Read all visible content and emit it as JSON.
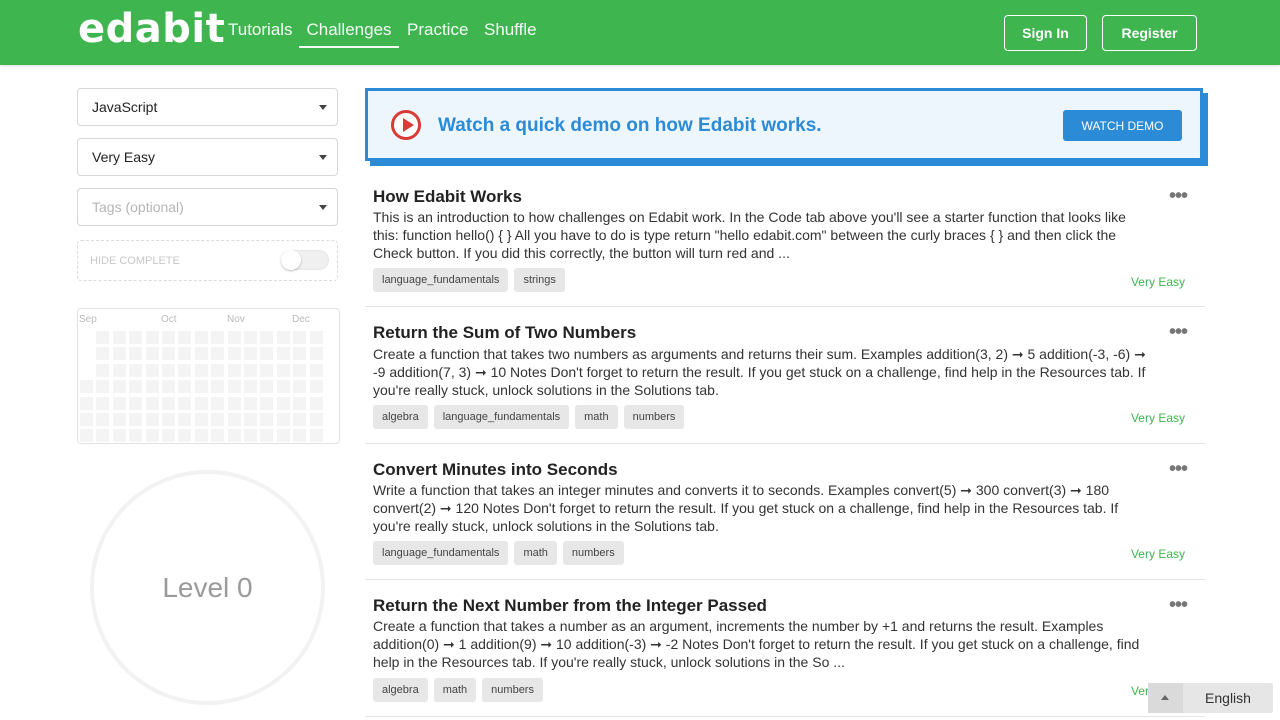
{
  "header": {
    "logo": "edabit",
    "nav": [
      "Tutorials",
      "Challenges",
      "Practice",
      "Shuffle"
    ],
    "active_nav": "Challenges",
    "sign_in": "Sign In",
    "register": "Register"
  },
  "filters": {
    "language": "JavaScript",
    "difficulty": "Very Easy",
    "tags_placeholder": "Tags (optional)",
    "hide_complete": "HIDE COMPLETE",
    "hide_complete_on": false
  },
  "activity": {
    "months": [
      "Sep",
      "Oct",
      "Nov",
      "Dec"
    ]
  },
  "level": {
    "label": "Level 0"
  },
  "demo_banner": {
    "text": "Watch a quick demo on how Edabit works.",
    "button": "WATCH DEMO"
  },
  "challenges": [
    {
      "title": "How Edabit Works",
      "description": "This is an introduction to how challenges on Edabit work. In the Code tab above you'll see a starter function that looks like this: function hello() { } All you have to do is type return \"hello edabit.com\" between the curly braces { } and then click the Check button. If you did this correctly, the button will turn red and ...",
      "tags": [
        "language_fundamentals",
        "strings"
      ],
      "difficulty": "Very Easy"
    },
    {
      "title": "Return the Sum of Two Numbers",
      "description": "Create a function that takes two numbers as arguments and returns their sum. Examples addition(3, 2) ➞ 5 addition(-3, -6) ➞ -9 addition(7, 3) ➞ 10 Notes Don't forget to return the result. If you get stuck on a challenge, find help in the Resources tab. If you're really stuck, unlock solutions in the Solutions tab.",
      "tags": [
        "algebra",
        "language_fundamentals",
        "math",
        "numbers"
      ],
      "difficulty": "Very Easy"
    },
    {
      "title": "Convert Minutes into Seconds",
      "description": "Write a function that takes an integer minutes and converts it to seconds. Examples convert(5) ➞ 300 convert(3) ➞ 180 convert(2) ➞ 120 Notes Don't forget to return the result. If you get stuck on a challenge, find help in the Resources tab. If you're really stuck, unlock solutions in the Solutions tab.",
      "tags": [
        "language_fundamentals",
        "math",
        "numbers"
      ],
      "difficulty": "Very Easy"
    },
    {
      "title": "Return the Next Number from the Integer Passed",
      "description": "Create a function that takes a number as an argument, increments the number by +1 and returns the result. Examples addition(0) ➞ 1 addition(9) ➞ 10 addition(-3) ➞ -2 Notes Don't forget to return the result. If you get stuck on a challenge, find help in the Resources tab. If you're really stuck, unlock solutions in the So ...",
      "tags": [
        "algebra",
        "math",
        "numbers"
      ],
      "difficulty": "Very Easy"
    }
  ],
  "language_selector": "English",
  "colors": {
    "brand_green": "#3fb550",
    "demo_blue": "#2b8bd6",
    "play_red": "#d93b35"
  }
}
